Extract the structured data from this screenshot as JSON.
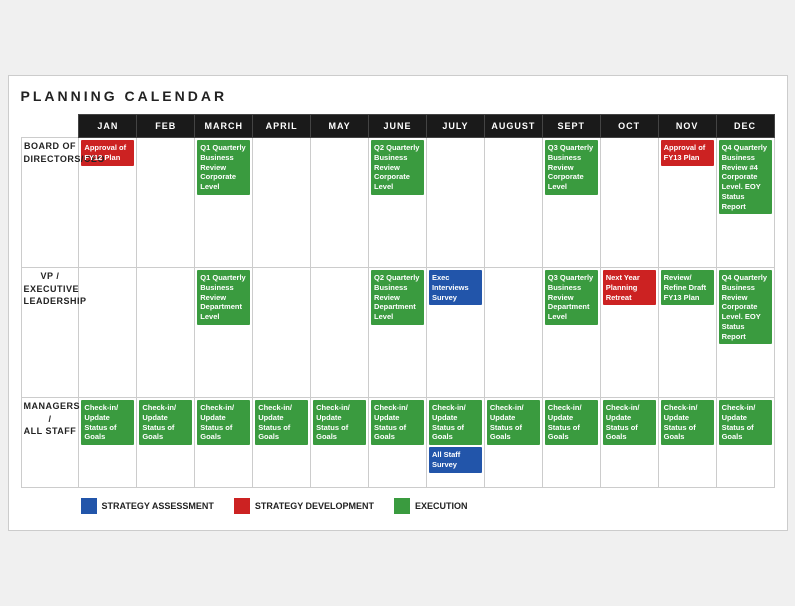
{
  "title": "PLANNING CALENDAR",
  "months": [
    "JAN",
    "FEB",
    "MARCH",
    "APRIL",
    "MAY",
    "JUNE",
    "JULY",
    "AUGUST",
    "SEPT",
    "OCT",
    "NOV",
    "DEC"
  ],
  "rows": [
    {
      "label": "BOARD OF\nDIRECTORS/CEO",
      "cells": {
        "JAN": [
          {
            "text": "Approval of FY12 Plan",
            "type": "red"
          }
        ],
        "FEB": [],
        "MARCH": [
          {
            "text": "Q1 Quarterly Business Review Corporate Level",
            "type": "green"
          }
        ],
        "APRIL": [],
        "MAY": [],
        "JUNE": [
          {
            "text": "Q2 Quarterly Business Review Corporate Level",
            "type": "green"
          }
        ],
        "JULY": [],
        "AUGUST": [],
        "SEPT": [
          {
            "text": "Q3 Quarterly Business Review Corporate Level",
            "type": "green"
          }
        ],
        "OCT": [],
        "NOV": [
          {
            "text": "Approval of FY13 Plan",
            "type": "red"
          }
        ],
        "DEC": [
          {
            "text": "Q4 Quarterly Business Review #4 Corporate Level. EOY Status Report",
            "type": "green"
          }
        ]
      }
    },
    {
      "label": "VP / EXECUTIVE\nLEADERSHIP",
      "cells": {
        "JAN": [],
        "FEB": [],
        "MARCH": [
          {
            "text": "Q1 Quarterly Business Review Department Level",
            "type": "green"
          }
        ],
        "APRIL": [],
        "MAY": [],
        "JUNE": [
          {
            "text": "Q2 Quarterly Business Review Department Level",
            "type": "green"
          }
        ],
        "JULY": [
          {
            "text": "Exec Interviews Survey",
            "type": "blue"
          }
        ],
        "AUGUST": [],
        "SEPT": [
          {
            "text": "Q3 Quarterly Business Review Department Level",
            "type": "green"
          }
        ],
        "OCT": [
          {
            "text": "Next Year Planning Retreat",
            "type": "red"
          }
        ],
        "NOV": [
          {
            "text": "Review/ Refine Draft FY13 Plan",
            "type": "green"
          }
        ],
        "DEC": [
          {
            "text": "Q4 Quarterly Business Review Corporate Level. EOY Status Report",
            "type": "green"
          }
        ]
      }
    },
    {
      "label": "MANAGERS /\nALL STAFF",
      "cells": {
        "JAN": [
          {
            "text": "Check-in/ Update Status of Goals",
            "type": "green"
          }
        ],
        "FEB": [
          {
            "text": "Check-in/ Update Status of Goals",
            "type": "green"
          }
        ],
        "MARCH": [
          {
            "text": "Check-in/ Update Status of Goals",
            "type": "green"
          }
        ],
        "APRIL": [
          {
            "text": "Check-in/ Update Status of Goals",
            "type": "green"
          }
        ],
        "MAY": [
          {
            "text": "Check-in/ Update Status of Goals",
            "type": "green"
          }
        ],
        "JUNE": [
          {
            "text": "Check-in/ Update Status of Goals",
            "type": "green"
          }
        ],
        "JULY": [
          {
            "text": "Check-in/ Update Status of Goals",
            "type": "green"
          },
          {
            "text": "All Staff Survey",
            "type": "blue"
          }
        ],
        "AUGUST": [
          {
            "text": "Check-in/ Update Status of Goals",
            "type": "green"
          }
        ],
        "SEPT": [
          {
            "text": "Check-in/ Update Status of Goals",
            "type": "green"
          }
        ],
        "OCT": [
          {
            "text": "Check-in/ Update Status of Goals",
            "type": "green"
          }
        ],
        "NOV": [
          {
            "text": "Check-in/ Update Status of Goals",
            "type": "green"
          }
        ],
        "DEC": [
          {
            "text": "Check-in/ Update Status of Goals",
            "type": "green"
          }
        ]
      }
    }
  ],
  "legend": [
    {
      "color": "blue",
      "label": "STRATEGY ASSESSMENT"
    },
    {
      "color": "red",
      "label": "STRATEGY DEVELOPMENT"
    },
    {
      "color": "green",
      "label": "EXECUTION"
    }
  ]
}
